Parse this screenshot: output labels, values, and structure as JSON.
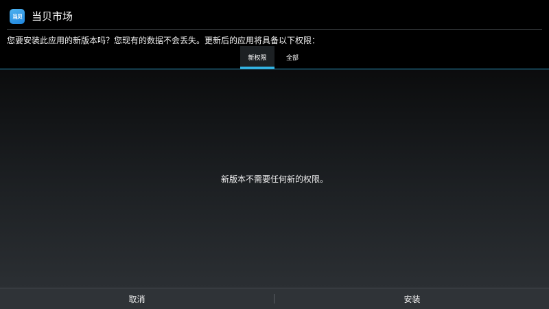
{
  "app": {
    "title": "当贝市场",
    "icon_text": "当贝",
    "icon_name": "dangbei-market-app-icon",
    "icon_color": "#2a9ee6"
  },
  "prompt": "您要安装此应用的新版本吗？您现有的数据不会丢失。更新后的应用将具备以下权限：",
  "tabs": [
    {
      "label": "新权限",
      "selected": true
    },
    {
      "label": "全部",
      "selected": false
    }
  ],
  "content": {
    "message": "新版本不需要任何新的权限。"
  },
  "buttons": {
    "cancel": "取消",
    "install": "安装"
  },
  "colors": {
    "accent": "#33b5e5",
    "bar_background": "#2f3337"
  }
}
